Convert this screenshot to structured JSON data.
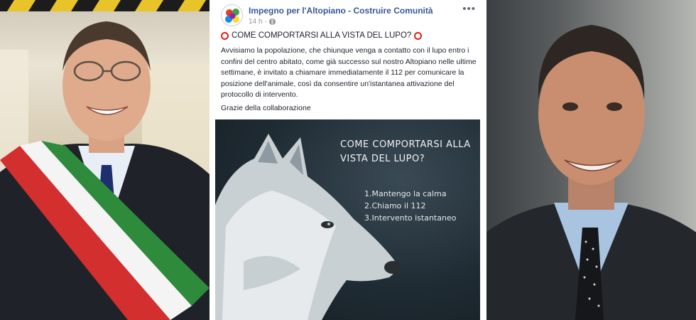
{
  "post": {
    "page_name": "Impegno per l'Altopiano - Costruire Comunità",
    "time": "14 h",
    "more_icon": "ellipsis-icon",
    "privacy_icon": "globe-icon",
    "headline_icon": "red-circle-icon",
    "headline": "COME COMPORTARSI ALLA VISTA DEL LUPO?",
    "body": "Avvisiamo la popolazione, che chiunque venga a contatto con il lupo entro i confini del centro abitato, come già successo sul nostro Altopiano nelle ultime settimane, è invitato a chiamare immediatamente il 112 per comunicare la posizione dell'animale, così da consentire un'istantanea attivazione del protocollo di intervento.",
    "thanks": "Grazie della collaborazione",
    "image": {
      "title_line1": "COME COMPORTARSI ALLA",
      "title_line2": "VISTA DEL LUPO?",
      "steps": [
        "1.Mantengo la calma",
        "2.Chiamo il 112",
        "3.Intervento istantaneo"
      ]
    }
  },
  "colors": {
    "page_name": "#385898",
    "alert_red": "#e0221a",
    "text": "#1d2129",
    "meta": "#90949c"
  }
}
